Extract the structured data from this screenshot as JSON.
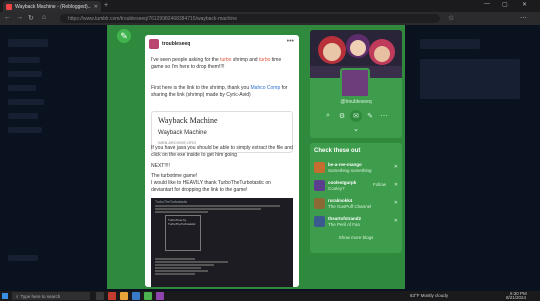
{
  "browser": {
    "tab_title": "Wayback Machine - (Reblogged)...",
    "url": "https://www.tumblr.com/troubleseeq/76129982468384715/wayback-machine",
    "win_controls": [
      "—",
      "▢",
      "✕"
    ]
  },
  "post": {
    "username": "troubleseeq",
    "menu": "•••",
    "para1_pre": "I've seen people asking for the ",
    "para1_hl1": "turbo",
    "para1_mid": " shrimp and ",
    "para1_hl2": "turbo",
    "para1_post": " time game so I'm here to drop them!!!!",
    "para2_pre": "First here is the link to the shrimp, thank you ",
    "para2_link": "Mahco Comp",
    "para2_post": " for sharing the link (shrimp) made by Cyric-Avid)",
    "wayback": {
      "title": "Wayback Machine",
      "subtitle": "Wayback Machine",
      "url": "WEB.ARCHIVE.ORG"
    },
    "para3": "If you have java you should be able to simply extract the file and click on the exe inside to get him going",
    "next": "NEXT!!!!",
    "para4": "The turbotime game!",
    "para5": "I would like to HEAVILY thank TurboTheTurbotastic on deviantart for dropping the link to the game!",
    "reblog_user": "TurboTheTurbotastic",
    "reblog_image_label": "TurboTime by TurboTheTurbotastic"
  },
  "blog": {
    "name": "@troubleseeq",
    "tools": [
      "search-icon",
      "gear-icon",
      "message-icon",
      "compose-icon",
      "more-icon"
    ],
    "chevron": "⌄"
  },
  "check_out": {
    "title": "Check these out",
    "items": [
      {
        "name": "be-a-ree-mango",
        "desc": "Something something",
        "follow": "",
        "color": "#c56d2e"
      },
      {
        "name": "coolestgurpk",
        "desc": "Cooley?",
        "follow": "Follow",
        "color": "#5b3e8e"
      },
      {
        "name": "ruralmokk4",
        "desc": "The GusPuff Channel",
        "follow": "",
        "color": "#8b6a35"
      },
      {
        "name": "theartofstrand2",
        "desc": "The Peril of Fan",
        "follow": "",
        "color": "#3a5a8f"
      }
    ],
    "show_more": "Show more blogs"
  },
  "taskbar": {
    "search_placeholder": "Type here to search",
    "weather": "63°F  Mostly cloudy",
    "time": "6:30 PM",
    "date": "8/21/2024"
  },
  "colors": {
    "tumblr_green": "#2f8a3e",
    "accent_orange": "#e0553d",
    "link_blue": "#2f6fd1"
  }
}
